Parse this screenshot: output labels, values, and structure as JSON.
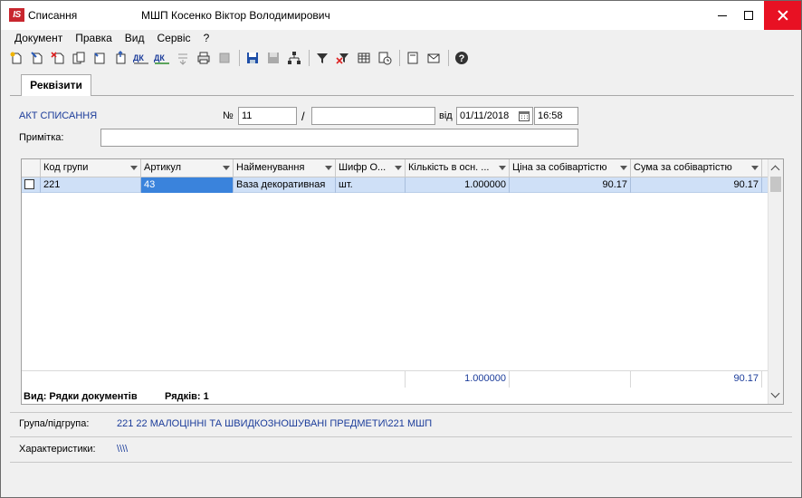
{
  "window": {
    "logo": "IS",
    "title": "Списання",
    "user": "МШП Косенко Віктор Володимирович"
  },
  "menu": [
    "Документ",
    "Правка",
    "Вид",
    "Сервіс",
    "?"
  ],
  "toolbar": {
    "icons": [
      "new-doc-icon",
      "edit-doc-icon",
      "delete-doc-icon",
      "copy-doc-icon",
      "paste-doc-icon",
      "export-doc-icon",
      "dk-icon",
      "dk-icon",
      "split-icon",
      "print-icon",
      "tool-icon",
      "save-icon",
      "save-disabled-icon",
      "tree-icon",
      "filter-icon",
      "clear-filter-icon",
      "table-icon",
      "history-icon",
      "form-icon",
      "mail-icon",
      "help-icon"
    ]
  },
  "tabs": [
    {
      "label": "Реквізити"
    }
  ],
  "form": {
    "title": "АКТ СПИСАННЯ",
    "number_label": "№",
    "number_value": "11",
    "number_suffix_value": "",
    "slash": "/",
    "date_label": "від",
    "date_value": "01/11/2018",
    "time_value": "16:58",
    "note_label": "Примітка:",
    "note_value": ""
  },
  "grid": {
    "columns": [
      "Код групи",
      "Артикул",
      "Найменування",
      "Шифр О...",
      "Кількість в осн. ...",
      "Ціна за собівартістю",
      "Сума за собівартістю"
    ],
    "rows": [
      {
        "code": "221",
        "article": "43",
        "name": "Ваза декоративная",
        "unit": "шт.",
        "quantity": "1.000000",
        "price": "90.17",
        "sum": "90.17"
      }
    ],
    "totals": {
      "quantity": "1.000000",
      "sum": "90.17"
    },
    "status_view": "Вид: Рядки документів",
    "status_rows": "Рядків: 1"
  },
  "info": {
    "group_label": "Група/підгрупа:",
    "group_value": "221 22 МАЛОЦІННІ ТА ШВИДКОЗНОШУВАНІ ПРЕДМЕТИ\\221 МШП",
    "char_label": "Характеристики:",
    "char_value": "\\\\\\\\"
  },
  "colors": {
    "accent_blue": "#1b3c9a",
    "row_selected": "#cfe0f7",
    "cell_selected": "#3a83dc",
    "close_red": "#e81123",
    "logo_red": "#c8262e"
  }
}
